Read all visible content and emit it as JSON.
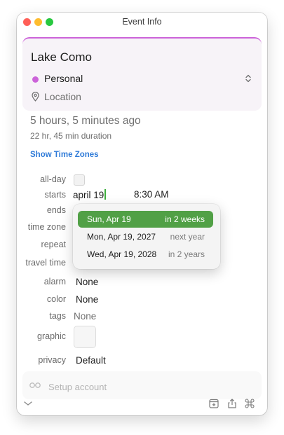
{
  "window": {
    "title": "Event Info"
  },
  "event": {
    "title": "Lake Como",
    "calendar": "Personal",
    "location_placeholder": "Location",
    "relative_time": "5 hours, 5 minutes ago",
    "duration": "22 hr, 45 min duration",
    "show_time_zones": "Show Time Zones"
  },
  "colors": {
    "calendar": "#cc63d9",
    "accent": "#51a046",
    "link": "#2f7bd8"
  },
  "fields": {
    "all_day_label": "all-day",
    "starts_label": "starts",
    "starts_date": "april 19",
    "starts_time": "8:30 AM",
    "ends_label": "ends",
    "time_zone_label": "time zone",
    "repeat_label": "repeat",
    "travel_time_label": "travel time",
    "alarm_label": "alarm",
    "alarm_value": "None",
    "color_label": "color",
    "color_value": "None",
    "tags_label": "tags",
    "tags_value": "None",
    "graphic_label": "graphic",
    "privacy_label": "privacy",
    "privacy_value": "Default"
  },
  "date_suggestions": [
    {
      "date": "Sun, Apr 19",
      "relative": "in 2 weeks",
      "selected": true
    },
    {
      "date": "Mon, Apr 19, 2027",
      "relative": "next year",
      "selected": false
    },
    {
      "date": "Wed, Apr 19, 2028",
      "relative": "in 2 years",
      "selected": false
    }
  ],
  "footer": {
    "setup_account": "Setup account"
  },
  "icons": {
    "calendar_chevron": "up-down-chevron-icon",
    "location": "location-pin-icon",
    "setup": "glasses-icon",
    "collapse": "chevron-down-icon",
    "add": "add-to-calendar-icon",
    "share": "share-icon",
    "command": "command-icon"
  }
}
